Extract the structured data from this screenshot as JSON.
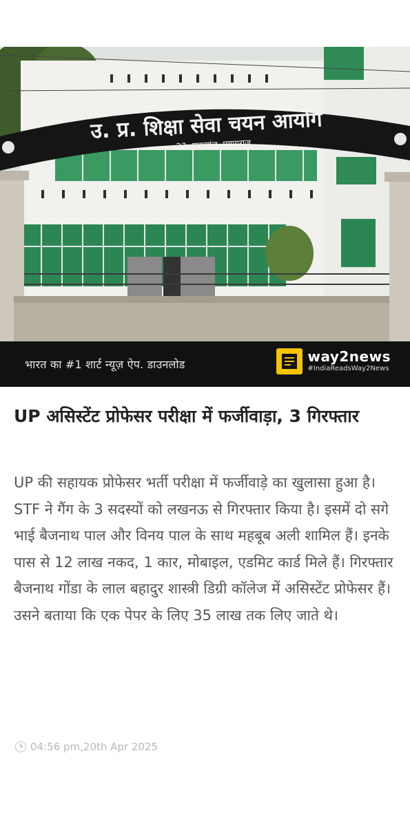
{
  "image": {
    "arch_sign_line1": "उ. प्र. शिक्षा सेवा चयन आयोग",
    "arch_sign_line2": "23- एलनगंज, प्रयागराज"
  },
  "promo": {
    "text": "भारत का #1 शार्ट न्यूज़ ऐप. डाउनलोड",
    "brand_name": "way2news",
    "brand_tag": "#IndiaReadsWay2News",
    "brand_color": "#f5c400",
    "logo_icon": "newspaper-icon"
  },
  "article": {
    "headline": "UP असिस्टेंट प्रोफेसर परीक्षा में फर्जीवाड़ा, 3 गिरफ्तार",
    "body": "UP की सहायक प्रोफेसर भर्ती परीक्षा में फर्जीवाड़े का खुलासा हुआ है। STF ने गैंग के 3 सदस्यों को लखनऊ से गिरफ्तार किया है। इसमें दो सगे भाई बैजनाथ पाल और विनय पाल के साथ महबूब अली शामिल हैं। इनके पास से 12 लाख नकद, 1 कार, मोबाइल, एडमिट कार्ड  मिले हैं। गिरफ्तार बैजनाथ गोंडा के लाल बहादुर शास्त्री डिग्री कॉलेज में असिस्टेंट प्रोफेसर हैं। उसने बताया कि एक पेपर के लिए 35 लाख तक लिए जाते थे।",
    "timestamp": "04:56 pm,20th Apr 2025",
    "timestamp_icon": "clock-icon"
  }
}
